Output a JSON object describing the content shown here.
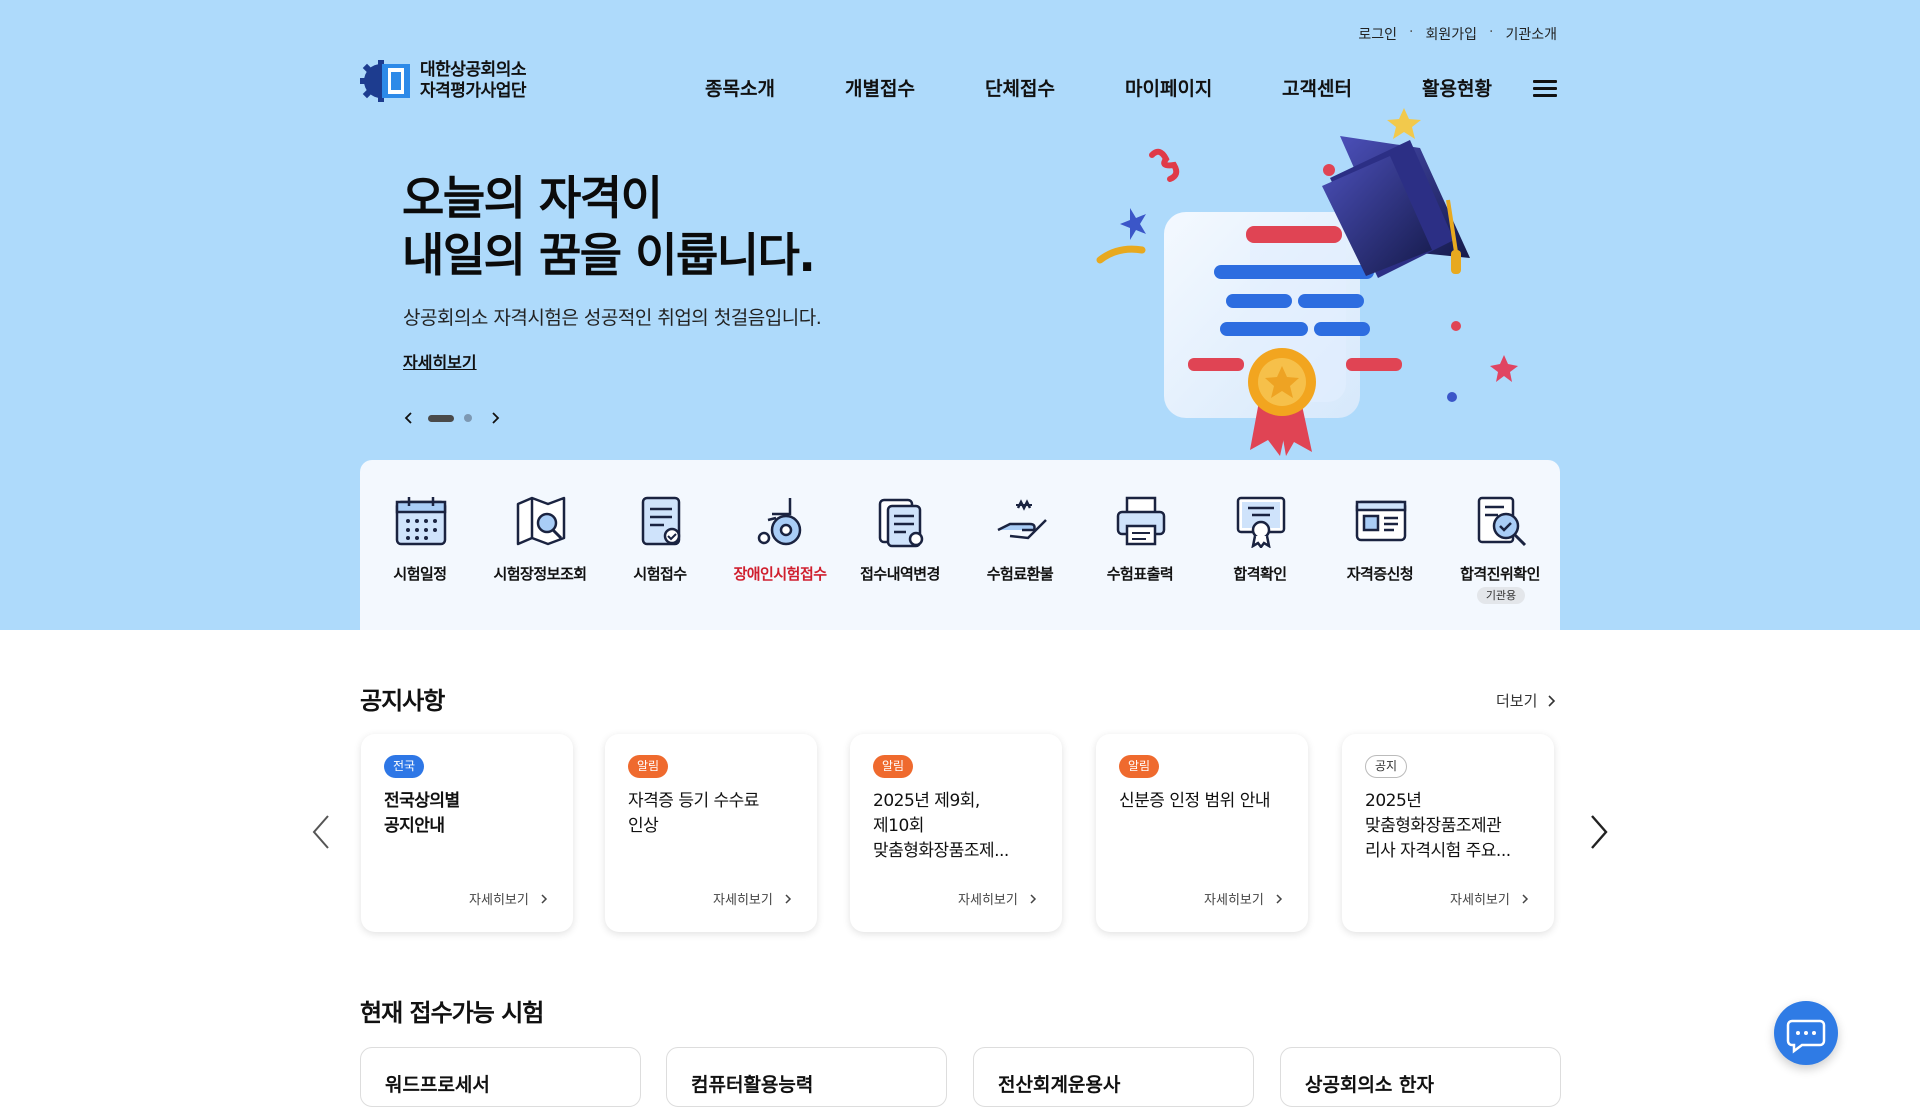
{
  "util_nav": [
    "로그인",
    "회원가입",
    "기관소개"
  ],
  "logo": {
    "line1": "대한상공회의소",
    "line2": "자격평가사업단"
  },
  "gnb": [
    "종목소개",
    "개별접수",
    "단체접수",
    "마이페이지",
    "고객센터",
    "활용현황"
  ],
  "hero": {
    "title_line1": "오늘의 자격이",
    "title_line2": "내일의 꿈을 이룹니다.",
    "subtitle": "상공회의소 자격시험은 성공적인 취업의 첫걸음입니다.",
    "more": "자세히보기"
  },
  "quick_menu": [
    {
      "label": "시험일정",
      "icon": "calendar-icon"
    },
    {
      "label": "시험장정보조회",
      "icon": "map-search-icon"
    },
    {
      "label": "시험접수",
      "icon": "document-check-icon"
    },
    {
      "label": "장애인시험접수",
      "icon": "wheelchair-icon"
    },
    {
      "label": "접수내역변경",
      "icon": "document-edit-icon"
    },
    {
      "label": "수험료환불",
      "icon": "refund-hand-icon"
    },
    {
      "label": "수험표출력",
      "icon": "printer-icon"
    },
    {
      "label": "합격확인",
      "icon": "certificate-icon"
    },
    {
      "label": "자격증신청",
      "icon": "id-card-icon"
    },
    {
      "label": "합격진위확인",
      "icon": "verify-search-icon",
      "badge": "기관용"
    }
  ],
  "notice": {
    "title": "공지사항",
    "more": "더보기",
    "cards": [
      {
        "badge": "전국",
        "line1": "전국상의별",
        "line2": "공지안내",
        "line3": "",
        "more": "자세히보기"
      },
      {
        "badge": "알림",
        "line1": "자격증 등기 수수료",
        "line2": "인상",
        "line3": "",
        "more": "자세히보기"
      },
      {
        "badge": "알림",
        "line1": "2025년 제9회,",
        "line2": "제10회",
        "line3": "맞춤형화장품조제...",
        "more": "자세히보기"
      },
      {
        "badge": "알림",
        "line1": "신분증 인정 범위 안내",
        "line2": "",
        "line3": "",
        "more": "자세히보기"
      },
      {
        "badge": "공지",
        "line1": "2025년",
        "line2": "맞춤형화장품조제관",
        "line3": "리사 자격시험 주요...",
        "more": "자세히보기"
      }
    ]
  },
  "exams": {
    "title": "현재 접수가능 시험",
    "items": [
      "워드프로세서",
      "컴퓨터활용능력",
      "전산회계운용사",
      "상공회의소 한자"
    ]
  },
  "colors": {
    "hero_bg": "#aedafb",
    "accent_blue": "#2e77e6",
    "accent_orange": "#ef6a2e",
    "accent_red": "#d01f2e"
  }
}
